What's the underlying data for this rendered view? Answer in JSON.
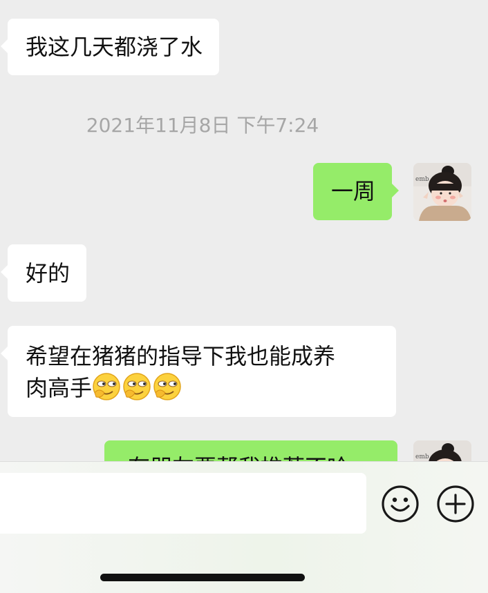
{
  "messages": [
    {
      "side": "in",
      "text": "我这几天都浇了水"
    },
    {
      "side": "out",
      "text": "一周"
    },
    {
      "side": "in",
      "text": "好的"
    },
    {
      "side": "in",
      "text": "希望在猪猪的指导下我也能成养",
      "text_line2": "肉高手"
    },
    {
      "side": "out",
      "text": "有朋友要帮我推荐不哈"
    }
  ],
  "timestamp": "2021年11月8日 下午7:24",
  "icons": {
    "emoji_button": "smiley-face-icon",
    "plus_button": "plus-circle-icon",
    "inline_emoji": "smirk-emoji-icon"
  },
  "input": {
    "value": "",
    "placeholder": ""
  },
  "colors": {
    "chat_background": "#ededed",
    "outgoing_bubble": "#95ec69",
    "incoming_bubble": "#ffffff",
    "timestamp_text": "#a6a6a6"
  }
}
